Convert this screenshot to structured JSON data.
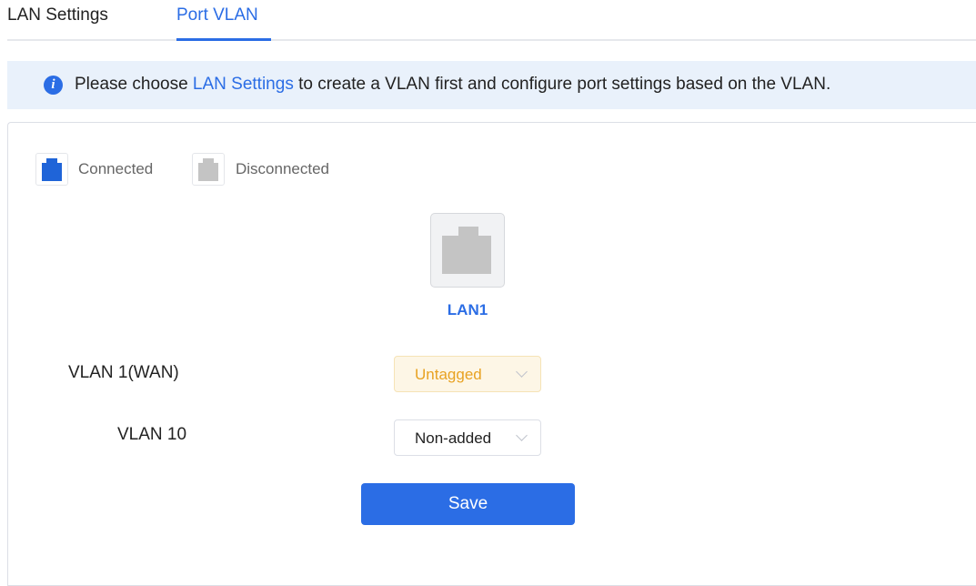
{
  "tabs": [
    {
      "label": "LAN Settings",
      "active": false
    },
    {
      "label": "Port VLAN",
      "active": true
    }
  ],
  "notice": {
    "icon": "info-icon",
    "text_before": "Please choose ",
    "link": "LAN Settings",
    "text_after": " to create a VLAN first and configure port settings based on the VLAN."
  },
  "legend": {
    "connected": {
      "label": "Connected",
      "color": "#1f64d8"
    },
    "disconnected": {
      "label": "Disconnected",
      "color": "#c4c4c4"
    }
  },
  "port": {
    "name": "LAN1",
    "status": "disconnected",
    "icon": "ethernet-port-icon"
  },
  "vlans": [
    {
      "label": "VLAN 1(WAN)",
      "mode": "Untagged"
    },
    {
      "label": "VLAN 10",
      "mode": "Non-added"
    }
  ],
  "save_label": "Save",
  "colors": {
    "accent": "#2b6de5",
    "untagged": "#e8a222"
  }
}
